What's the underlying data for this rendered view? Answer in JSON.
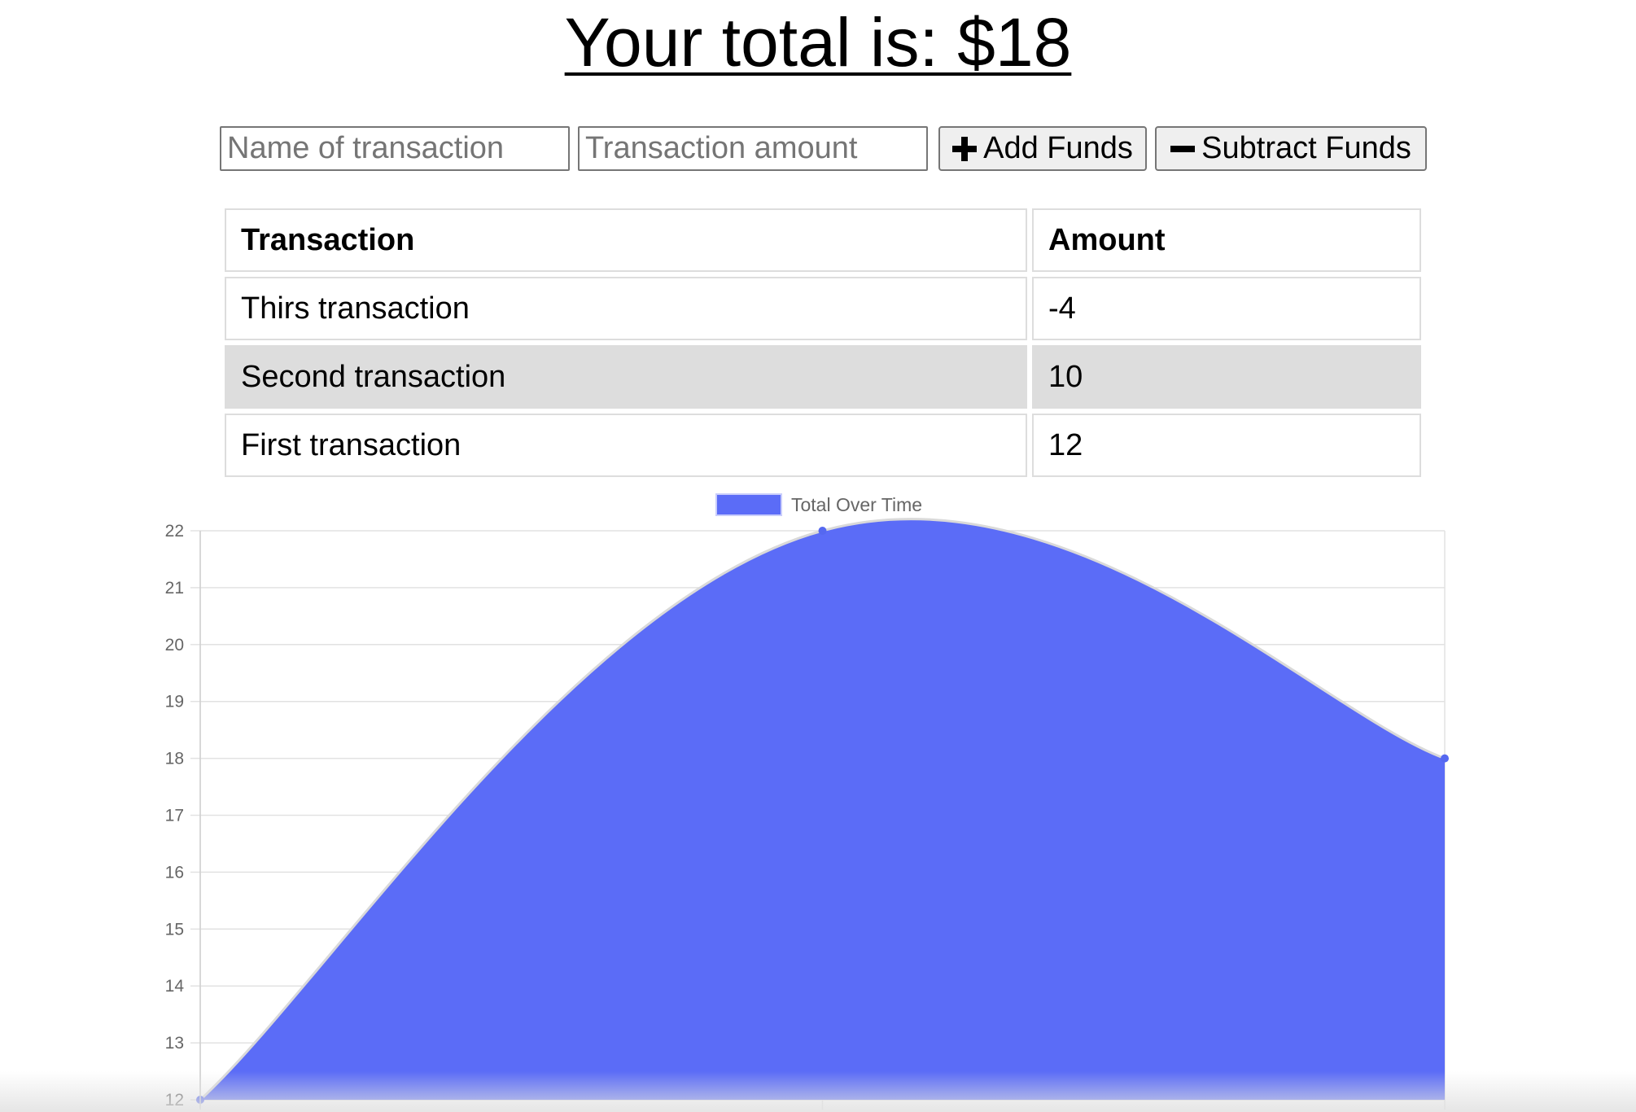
{
  "header": {
    "total_text": "Your total is: $18"
  },
  "form": {
    "name_placeholder": "Name of transaction",
    "amount_placeholder": "Transaction amount",
    "add_label": "Add Funds",
    "subtract_label": "Subtract Funds"
  },
  "table": {
    "headers": [
      "Transaction",
      "Amount"
    ],
    "rows": [
      {
        "name": "Thirs transaction",
        "amount": "-4"
      },
      {
        "name": "Second transaction",
        "amount": "10"
      },
      {
        "name": "First transaction",
        "amount": "12"
      }
    ],
    "stripe_color": "#dddddd"
  },
  "chart_data": {
    "type": "area",
    "legend": {
      "label": "Total Over Time",
      "position": "top"
    },
    "series": [
      {
        "name": "Total Over Time",
        "values": [
          12,
          22,
          18
        ],
        "color": "#5b6cf7"
      }
    ],
    "ylim": [
      12,
      22
    ],
    "yticks": [
      12,
      13,
      14,
      15,
      16,
      17,
      18,
      19,
      20,
      21,
      22
    ],
    "grid": true,
    "xlabel": "",
    "ylabel": ""
  },
  "icons": {
    "add": "plus-icon",
    "subtract": "minus-icon"
  }
}
